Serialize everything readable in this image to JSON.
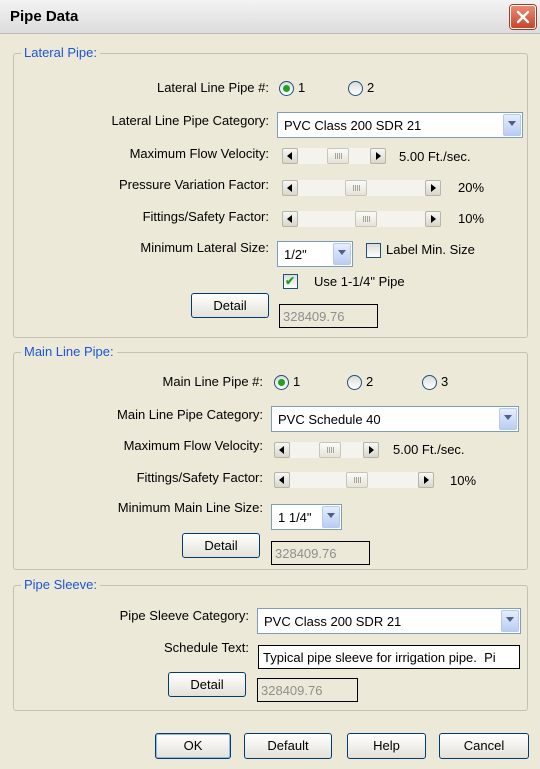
{
  "window": {
    "title": "Pipe Data"
  },
  "lateral": {
    "legend": "Lateral Pipe:",
    "pipe_no_label": "Lateral Line Pipe #:",
    "pipe_options": [
      "1",
      "2"
    ],
    "category_label": "Lateral Line Pipe Category:",
    "category_value": "PVC Class 200 SDR 21",
    "velocity_label": "Maximum Flow Velocity:",
    "velocity_value": "5.00 Ft./sec.",
    "pressure_label": "Pressure Variation Factor:",
    "pressure_value": "20%",
    "fittings_label": "Fittings/Safety Factor:",
    "fittings_value": "10%",
    "min_size_label": "Minimum Lateral Size:",
    "min_size_value": "1/2\"",
    "label_min_size": "Label Min. Size",
    "use_pipe_label": "Use 1-1/4\" Pipe",
    "detail_label": "Detail",
    "detail_value": "328409.76"
  },
  "main": {
    "legend": "Main Line Pipe:",
    "pipe_no_label": "Main Line Pipe #:",
    "pipe_options": [
      "1",
      "2",
      "3"
    ],
    "category_label": "Main Line Pipe Category:",
    "category_value": "PVC Schedule 40",
    "velocity_label": "Maximum Flow Velocity:",
    "velocity_value": "5.00 Ft./sec.",
    "fittings_label": "Fittings/Safety Factor:",
    "fittings_value": "10%",
    "min_size_label": "Minimum Main Line Size:",
    "min_size_value": "1 1/4\"",
    "detail_label": "Detail",
    "detail_value": "328409.76"
  },
  "sleeve": {
    "legend": "Pipe Sleeve:",
    "category_label": "Pipe Sleeve Category:",
    "category_value": "PVC Class 200 SDR 21",
    "schedule_label": "Schedule Text:",
    "schedule_value": "Typical pipe sleeve for irrigation pipe.  Pi",
    "detail_label": "Detail",
    "detail_value": "328409.76"
  },
  "footer": {
    "ok": "OK",
    "default": "Default",
    "help": "Help",
    "cancel": "Cancel"
  },
  "state": {
    "lateral_pipe_selected": "1",
    "main_pipe_selected": "1",
    "label_min_size_checked": false,
    "use_pipe_checked": true
  },
  "colors": {
    "legend": "#1c55d6",
    "close_button": "#c9442a",
    "check_mark": "#21a121"
  }
}
